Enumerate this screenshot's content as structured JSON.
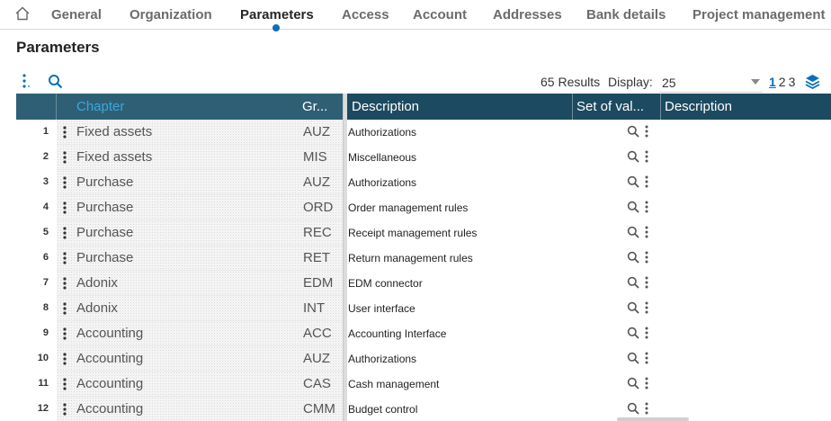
{
  "tabs": [
    {
      "label": "General",
      "active": false
    },
    {
      "label": "Organization",
      "active": false
    },
    {
      "label": "Parameters",
      "active": true
    },
    {
      "label": "Access",
      "active": false
    },
    {
      "label": "Account",
      "active": false
    },
    {
      "label": "Addresses",
      "active": false
    },
    {
      "label": "Bank details",
      "active": false
    },
    {
      "label": "Project management",
      "active": false
    }
  ],
  "page_title": "Parameters",
  "toolbar": {
    "results_text": "65 Results",
    "display_label": "Display:",
    "display_value": "25",
    "pages": [
      "1",
      "2",
      "3"
    ],
    "current_page": "1"
  },
  "grid": {
    "columns": [
      "Chapter",
      "Gr...",
      "Description",
      "Set of val...",
      "Description"
    ],
    "sorted_column": "Chapter",
    "rows": [
      {
        "num": "1",
        "chapter": "Fixed assets",
        "group": "AUZ",
        "description": "Authorizations"
      },
      {
        "num": "2",
        "chapter": "Fixed assets",
        "group": "MIS",
        "description": "Miscellaneous"
      },
      {
        "num": "3",
        "chapter": "Purchase",
        "group": "AUZ",
        "description": "Authorizations"
      },
      {
        "num": "4",
        "chapter": "Purchase",
        "group": "ORD",
        "description": "Order management rules"
      },
      {
        "num": "5",
        "chapter": "Purchase",
        "group": "REC",
        "description": "Receipt management rules"
      },
      {
        "num": "6",
        "chapter": "Purchase",
        "group": "RET",
        "description": "Return management rules"
      },
      {
        "num": "7",
        "chapter": "Adonix",
        "group": "EDM",
        "description": "EDM connector"
      },
      {
        "num": "8",
        "chapter": "Adonix",
        "group": "INT",
        "description": "User interface"
      },
      {
        "num": "9",
        "chapter": "Accounting",
        "group": "ACC",
        "description": "Accounting Interface"
      },
      {
        "num": "10",
        "chapter": "Accounting",
        "group": "AUZ",
        "description": "Authorizations"
      },
      {
        "num": "11",
        "chapter": "Accounting",
        "group": "CAS",
        "description": "Cash management"
      },
      {
        "num": "12",
        "chapter": "Accounting",
        "group": "CMM",
        "description": "Budget control"
      }
    ]
  },
  "colors": {
    "header_bg": "#1c4a60",
    "accent": "#0b6fb8",
    "sorted_header_text": "#3aa7dc"
  },
  "icons": [
    "home-icon",
    "menu-dots-icon",
    "search-icon",
    "chevron-down-icon",
    "layers-icon",
    "row-menu-icon",
    "row-search-icon",
    "more-vertical-icon"
  ]
}
